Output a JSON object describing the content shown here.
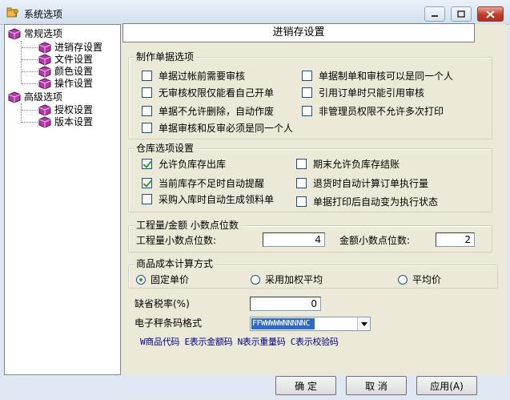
{
  "window": {
    "title": "系统选项",
    "icons": {
      "app": "folder-key-icon",
      "minimize": "minimize-icon",
      "maximize": "maximize-icon",
      "close": "close-icon"
    }
  },
  "tree": {
    "items": [
      {
        "label": "常规选项",
        "icon": "cube-icon"
      },
      {
        "label": "进销存设置",
        "icon": "cube-icon"
      },
      {
        "label": "文件设置",
        "icon": "cube-icon"
      },
      {
        "label": "颜色设置",
        "icon": "cube-icon"
      },
      {
        "label": "操作设置",
        "icon": "cube-icon"
      },
      {
        "label": "高级选项",
        "icon": "cube-icon"
      },
      {
        "label": "授权设置",
        "icon": "cube-icon"
      },
      {
        "label": "版本设置",
        "icon": "cube-icon"
      }
    ]
  },
  "pane": {
    "header": "进销存设置"
  },
  "doc_options": {
    "title": "制作单据选项",
    "items": [
      {
        "label": "单据过帐前需要审核",
        "checked": false
      },
      {
        "label": "单据制单和审核可以是同一个人",
        "checked": false
      },
      {
        "label": "无审核权限仅能看自己开单",
        "checked": false
      },
      {
        "label": "引用订单时只能引用审核",
        "checked": false
      },
      {
        "label": "单据不允许删除，自动作废",
        "checked": false
      },
      {
        "label": "非管理员权限不允许多次打印",
        "checked": false
      },
      {
        "label": "单据审核和反审必须是同一个人",
        "checked": false
      }
    ]
  },
  "warehouse": {
    "title": "仓库选项设置",
    "items": [
      {
        "label": "允许负库存出库",
        "checked": true
      },
      {
        "label": "期末允许负库存结账",
        "checked": false
      },
      {
        "label": "当前库存不足时自动提醒",
        "checked": true
      },
      {
        "label": "退货时自动计算订单执行量",
        "checked": false
      },
      {
        "label": "采购入库时自动生成领料单",
        "checked": false
      },
      {
        "label": "单据打印后自动变为执行状态",
        "checked": false
      }
    ]
  },
  "decimals": {
    "title": "工程量/金额 小数点位数",
    "qty_label": "工程量小数点位数:",
    "qty_value": "4",
    "amount_label": "金额小数点位数:",
    "amount_value": "2"
  },
  "cost": {
    "title": "商品成本计算方式",
    "options": [
      {
        "label": "固定单价",
        "selected": true
      },
      {
        "label": "采用加权平均",
        "selected": false
      },
      {
        "label": "平均价",
        "selected": false
      }
    ]
  },
  "tax": {
    "label": "缺省税率(%)",
    "value": "0"
  },
  "barcode": {
    "label": "电子秤条码格式",
    "value": "FFWWWWWNNNNNC",
    "legend": "W商品代码 E表示金额码 N表示重量码 C表示校验码"
  },
  "buttons": {
    "ok": "确  定",
    "cancel": "取  消",
    "apply": "应用(A)"
  },
  "colors": {
    "accent": "#316ac5",
    "check": "#21a121",
    "close": "#c0392b"
  }
}
